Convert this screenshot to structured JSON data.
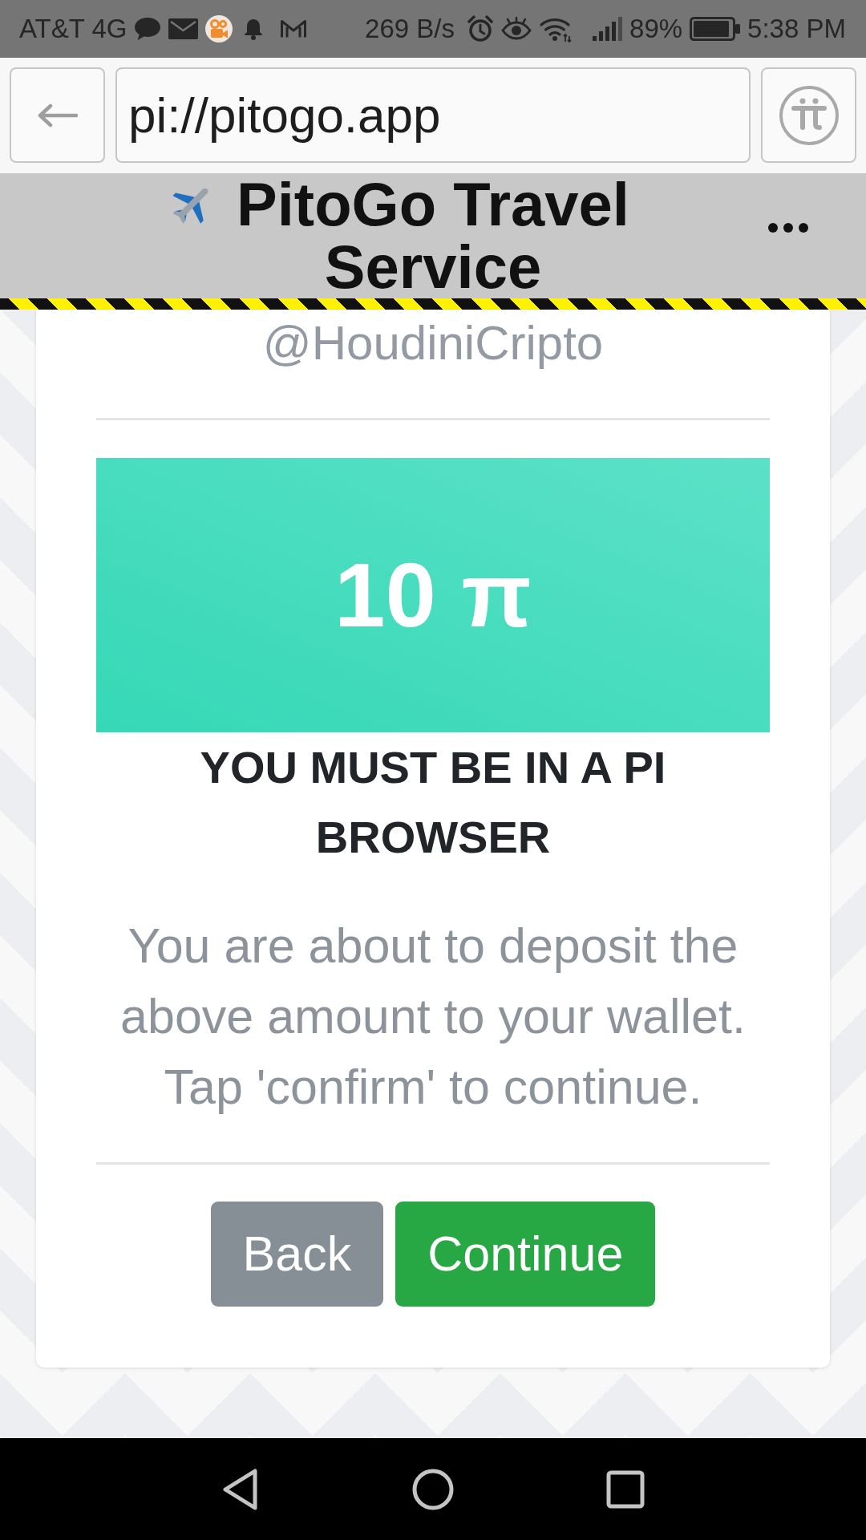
{
  "status_bar": {
    "carrier": "AT&T 4G",
    "network_speed": "269 B/s",
    "battery": "89%",
    "time": "5:38 PM"
  },
  "address_bar": {
    "url": "pi://pitogo.app"
  },
  "header": {
    "title": "PitoGo Travel Service"
  },
  "payment_card": {
    "username": "@HoudiniCripto",
    "amount": "10 π",
    "warning": "YOU MUST BE IN A PI BROWSER",
    "message": "You are about to deposit the above amount to your wallet. Tap 'confirm' to continue.",
    "buttons": [
      {
        "label": "Back",
        "kind": "secondary"
      },
      {
        "label": "Continue",
        "kind": "primary"
      }
    ]
  }
}
